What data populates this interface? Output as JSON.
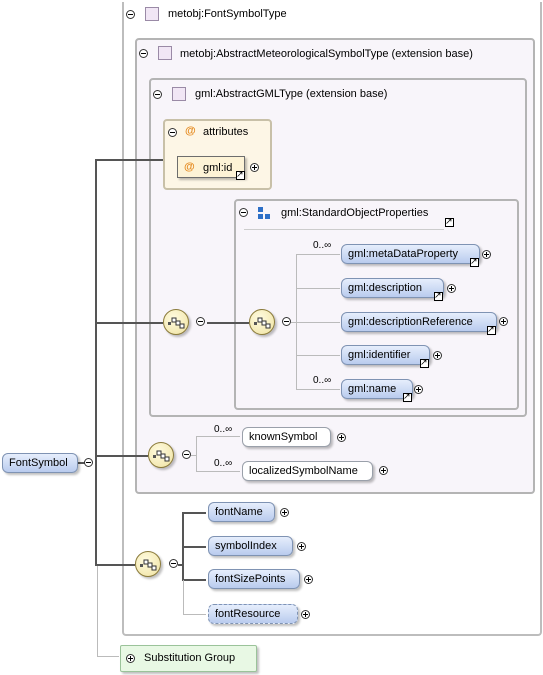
{
  "root": {
    "name": "FontSymbol"
  },
  "types": {
    "font_symbol_type": "metobj:FontSymbolType",
    "abstract_meteorological": "metobj:AbstractMeteorologicalSymbolType (extension base)",
    "abstract_gml": "gml:AbstractGMLType (extension base)"
  },
  "attributes": {
    "title": "attributes",
    "items": [
      "gml:id"
    ]
  },
  "standard_object_properties": {
    "title": "gml:StandardObjectProperties",
    "elements": [
      "gml:metaDataProperty",
      "gml:description",
      "gml:descriptionReference",
      "gml:identifier",
      "gml:name"
    ],
    "cardinalities": {
      "first": "0..∞",
      "last": "0..∞"
    }
  },
  "symbol_choice": {
    "elements": [
      "knownSymbol",
      "localizedSymbolName"
    ],
    "cardinalities": [
      "0..∞",
      "0..∞"
    ]
  },
  "font_sequence": {
    "elements": [
      "fontName",
      "symbolIndex",
      "fontSizePoints",
      "fontResource"
    ]
  },
  "substitution_group": {
    "label": "Substitution Group"
  },
  "colors": {
    "type_box_fill": "#f8f5fa",
    "attributes_fill": "#fdf6e6",
    "element_fill": "#c8d7f4",
    "substitution_fill": "#e8f8e4"
  }
}
